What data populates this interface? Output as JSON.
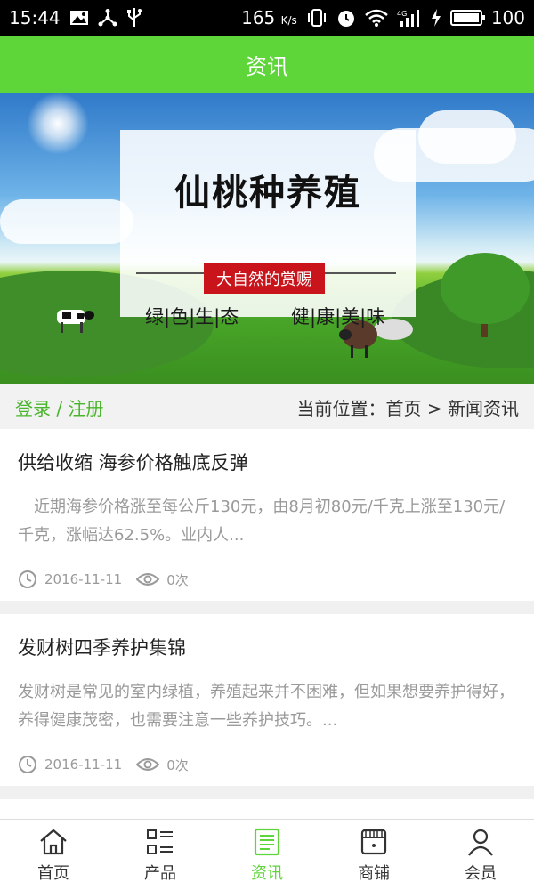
{
  "status_bar": {
    "time": "15:44",
    "left_icons": [
      "image-icon",
      "share-icon",
      "usb-icon"
    ],
    "network_speed": "165",
    "speed_unit": "K/s",
    "right_icons": [
      "vibrate-icon",
      "alarm-icon",
      "wifi-icon",
      "signal-4g-icon",
      "charging-icon",
      "battery-icon"
    ],
    "battery_level": "100"
  },
  "app_bar": {
    "title": "资讯"
  },
  "banner": {
    "title": "仙桃种养殖",
    "tag": "大自然的赏赐",
    "slogan_left": "绿|色|生|态",
    "slogan_right": "健|康|美|味"
  },
  "location_bar": {
    "login_label": "登录 / 注册",
    "breadcrumb": "当前位置：首页 > 新闻资讯"
  },
  "news": [
    {
      "title": "供给收缩 海参价格触底反弹",
      "summary": "　近期海参价格涨至每公斤130元，由8月初80元/千克上涨至130元/千克，涨幅达62.5%。业内人...",
      "date": "2016-11-11",
      "views": "0次"
    },
    {
      "title": "发财树四季养护集锦",
      "summary": "发财树是常见的室内绿植，养殖起来并不困难，但如果想要养护得好，养得健康茂密，也需要注意一些养护技巧。...",
      "date": "2016-11-11",
      "views": "0次"
    }
  ],
  "tabs": [
    {
      "label": "首页",
      "icon": "home-icon"
    },
    {
      "label": "产品",
      "icon": "list-grid-icon"
    },
    {
      "label": "资讯",
      "icon": "news-icon",
      "active": true
    },
    {
      "label": "商铺",
      "icon": "shop-icon"
    },
    {
      "label": "会员",
      "icon": "user-icon"
    }
  ],
  "colors": {
    "accent": "#5ed63a",
    "login_text": "#49b52b",
    "banner_tag": "#c8141a"
  }
}
